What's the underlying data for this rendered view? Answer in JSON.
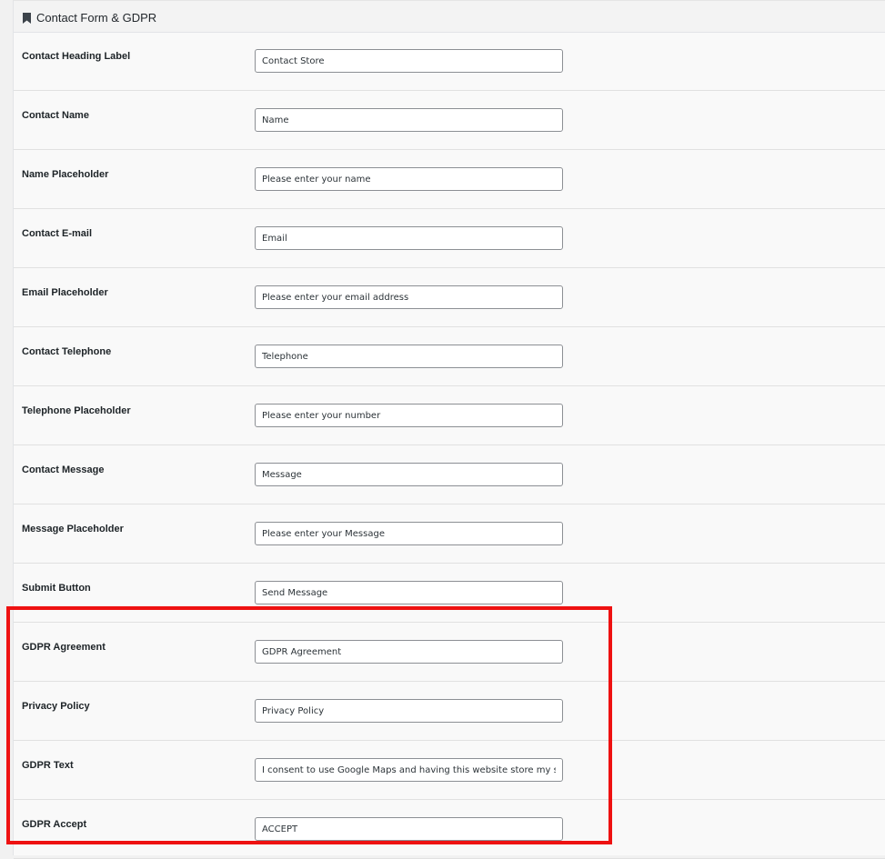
{
  "panel": {
    "title": "Contact Form & GDPR",
    "title_icon": "bookmark-icon"
  },
  "fields": [
    {
      "label": "Contact Heading Label",
      "value": "Contact Store"
    },
    {
      "label": "Contact Name",
      "value": "Name"
    },
    {
      "label": "Name Placeholder",
      "value": "Please enter your name"
    },
    {
      "label": "Contact E-mail",
      "value": "Email"
    },
    {
      "label": "Email Placeholder",
      "value": "Please enter your email address"
    },
    {
      "label": "Contact Telephone",
      "value": "Telephone"
    },
    {
      "label": "Telephone Placeholder",
      "value": "Please enter your number"
    },
    {
      "label": "Contact Message",
      "value": "Message"
    },
    {
      "label": "Message Placeholder",
      "value": "Please enter your Message"
    },
    {
      "label": "Submit Button",
      "value": "Send Message"
    },
    {
      "label": "GDPR Agreement",
      "value": "GDPR Agreement"
    },
    {
      "label": "Privacy Policy",
      "value": "Privacy Policy"
    },
    {
      "label": "GDPR Text",
      "value": "I consent to use Google Maps and having this website store my submitted information so they can respond to my inquiry."
    },
    {
      "label": "GDPR Accept",
      "value": "ACCEPT"
    }
  ],
  "colors": {
    "highlight": "#ee1111",
    "panel_bg": "#f9f9f9",
    "input_border": "#8c8f94"
  }
}
